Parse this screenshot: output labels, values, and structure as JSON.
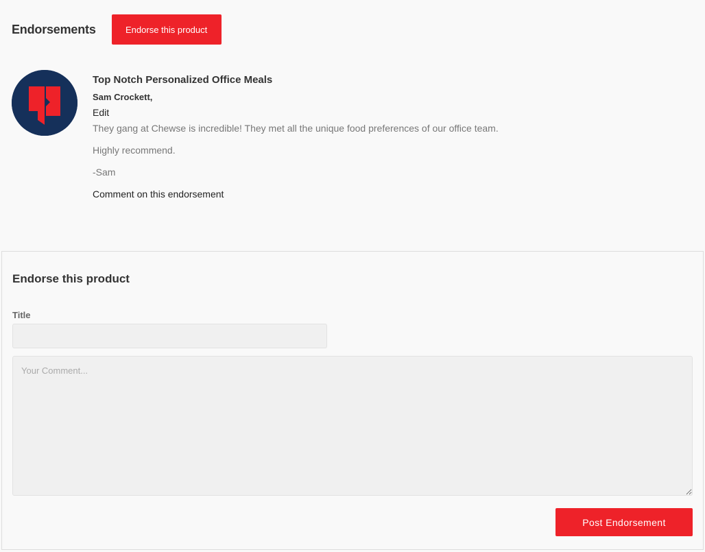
{
  "header": {
    "title": "Endorsements",
    "endorse_button": "Endorse this product"
  },
  "endorsement": {
    "title": "Top Notch Personalized Office Meals",
    "author": "Sam Crockett,",
    "edit_label": "Edit",
    "paragraphs": [
      "They gang at Chewse is incredible! They met all the unique food preferences of our office team.",
      "Highly recommend.",
      "-Sam"
    ],
    "comment_link": "Comment on this endorsement",
    "avatar_icon": "chewse-logo-icon"
  },
  "form": {
    "title": "Endorse this product",
    "title_label": "Title",
    "title_value": "",
    "title_placeholder": "",
    "comment_value": "",
    "comment_placeholder": "Your Comment...",
    "submit_label": "Post Endorsement"
  },
  "colors": {
    "accent": "#ee2229",
    "avatar_bg": "#15305a",
    "page_bg": "#f9f9f9"
  }
}
